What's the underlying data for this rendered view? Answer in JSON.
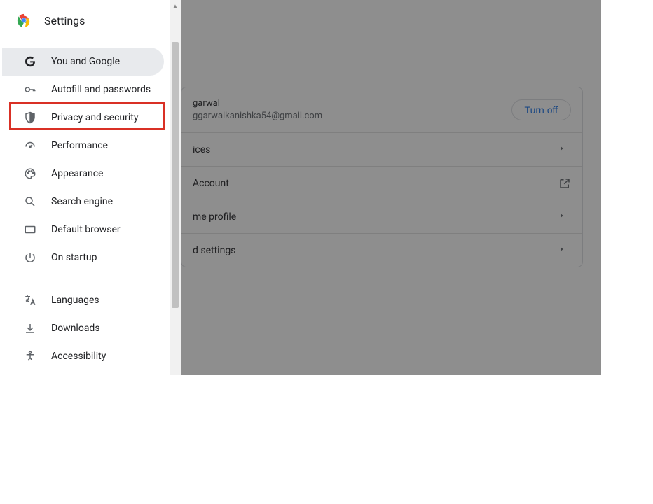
{
  "app_title": "Settings",
  "sidebar": {
    "group1": [
      {
        "icon": "google-icon",
        "label": "You and Google",
        "active": true
      },
      {
        "icon": "key-icon",
        "label": "Autofill and passwords",
        "active": false
      },
      {
        "icon": "shield-icon",
        "label": "Privacy and security",
        "active": false,
        "highlighted": true
      },
      {
        "icon": "speedometer-icon",
        "label": "Performance",
        "active": false
      },
      {
        "icon": "palette-icon",
        "label": "Appearance",
        "active": false
      },
      {
        "icon": "search-icon",
        "label": "Search engine",
        "active": false
      },
      {
        "icon": "browser-icon",
        "label": "Default browser",
        "active": false
      },
      {
        "icon": "power-icon",
        "label": "On startup",
        "active": false
      }
    ],
    "group2": [
      {
        "icon": "translate-icon",
        "label": "Languages"
      },
      {
        "icon": "download-icon",
        "label": "Downloads"
      },
      {
        "icon": "accessibility-icon",
        "label": "Accessibility"
      }
    ]
  },
  "main": {
    "profile": {
      "name_partial": "garwal",
      "email_partial": "ggarwalkanishka54@gmail.com"
    },
    "turn_off_label": "Turn off",
    "rows": [
      {
        "label_partial": "ices",
        "icon": "chevron"
      },
      {
        "label_partial": "Account",
        "icon": "external"
      },
      {
        "label_partial": "me profile",
        "icon": "chevron"
      },
      {
        "label_partial": "d settings",
        "icon": "chevron"
      }
    ]
  }
}
